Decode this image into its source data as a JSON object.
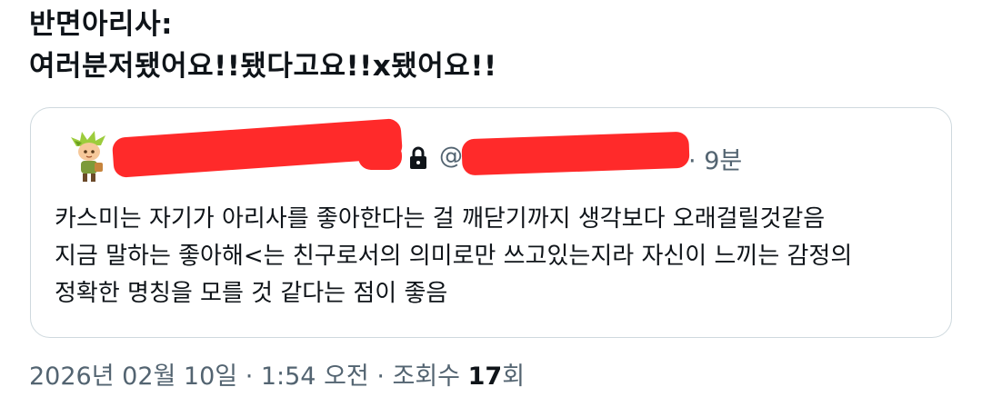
{
  "tweet": {
    "text": "반면아리사:\n여러분저됐어요!!됐다고요!!x됐어요!!"
  },
  "quoted_tweet": {
    "avatar_icon": "cookie-character-avatar",
    "lock_icon": "lock-icon",
    "handle_prefix": "@",
    "time_separator": "·",
    "time": "9분",
    "body": "카스미는 자기가 아리사를 좋아한다는 걸 깨닫기까지 생각보다 오래걸릴것같음\n지금 말하는 좋아해<는 친구로서의 의미로만 쓰고있는지라 자신이 느끼는 감정의\n정확한 명칭을 모를 것 같다는 점이 좋음",
    "redaction_color": "#ff2a2a"
  },
  "footer": {
    "date_time": "2026년 02월 10일 · 1:54 오전 · 조회수 ",
    "view_count": "17",
    "view_suffix": "회"
  }
}
